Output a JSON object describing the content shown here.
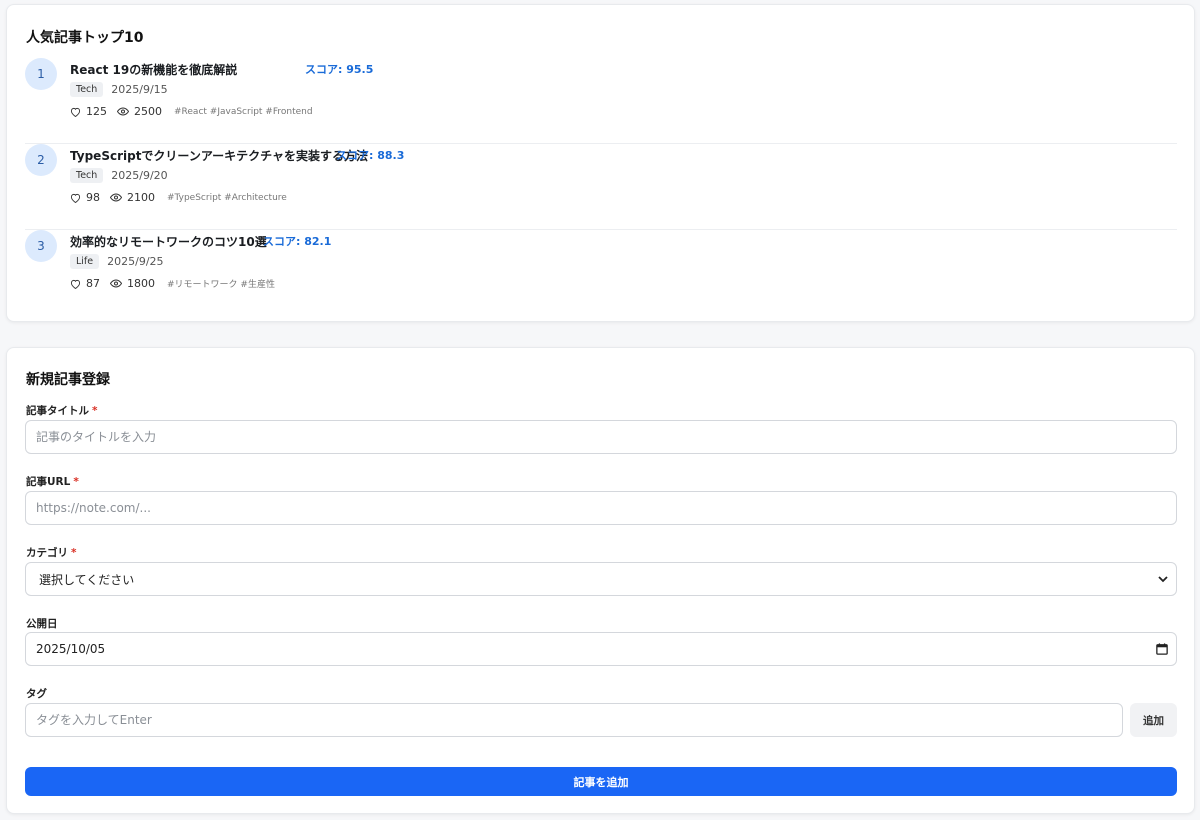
{
  "ranking": {
    "title": "人気記事トップ10",
    "items": [
      {
        "rank": "1",
        "title": "React 19の新機能を徹底解説",
        "score": "スコア: 95.5",
        "category": "Tech",
        "date": "2025/9/15",
        "likes": "125",
        "views": "2500",
        "tags": "#React #JavaScript #Frontend"
      },
      {
        "rank": "2",
        "title": "TypeScriptでクリーンアーキテクチャを実装する方法",
        "score": "スコア: 88.3",
        "category": "Tech",
        "date": "2025/9/20",
        "likes": "98",
        "views": "2100",
        "tags": "#TypeScript #Architecture"
      },
      {
        "rank": "3",
        "title": "効率的なリモートワークのコツ10選",
        "score": "スコア: 82.1",
        "category": "Life",
        "date": "2025/9/25",
        "likes": "87",
        "views": "1800",
        "tags": "#リモートワーク #生産性"
      }
    ]
  },
  "form": {
    "title": "新規記事登録",
    "required_mark": "*",
    "article_title": {
      "label": "記事タイトル",
      "placeholder": "記事のタイトルを入力",
      "value": ""
    },
    "article_url": {
      "label": "記事URL",
      "placeholder": "https://note.com/...",
      "value": ""
    },
    "category": {
      "label": "カテゴリ",
      "selected": "選択してください"
    },
    "publish_date": {
      "label": "公開日",
      "value": "2025/10/05"
    },
    "tags": {
      "label": "タグ",
      "placeholder": "タグを入力してEnter",
      "add_label": "追加"
    },
    "submit_label": "記事を追加"
  },
  "icons": {
    "like": "heart-icon",
    "views": "eye-icon",
    "select": "chevron-down-icon",
    "calendar": "calendar-icon"
  },
  "colors": {
    "accent": "#1a66f5",
    "score": "#1a6bd8",
    "badge_bg": "#dceafd",
    "required": "#d93025"
  }
}
